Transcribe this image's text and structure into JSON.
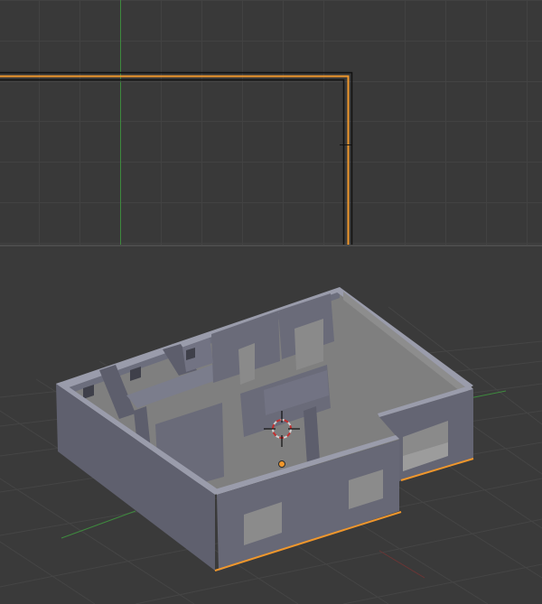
{
  "app": {
    "colors": {
      "viewport_bg": "#393939",
      "grid_line": "#424242",
      "y_axis": "#3e8a3e",
      "x_axis": "#7d3a3a",
      "selection_outline": "#f0972c",
      "wall_face_front": "#6a6b79",
      "wall_face_side": "#5d5e6c",
      "wall_top": "#8a8c9c",
      "floor": "#858585",
      "origin_dot": "#f0972c"
    }
  },
  "top_viewport": {
    "view": "top-orthographic",
    "grid": true,
    "y_axis_visible": true,
    "selected_object_outline": true
  },
  "bottom_viewport": {
    "view": "user-perspective",
    "grid": true,
    "x_axis_visible": true,
    "y_axis_visible": true,
    "object": "house-floorplan-mesh",
    "selected": true,
    "cursor_3d": "3d-cursor-icon",
    "origin": "object-origin-dot"
  }
}
